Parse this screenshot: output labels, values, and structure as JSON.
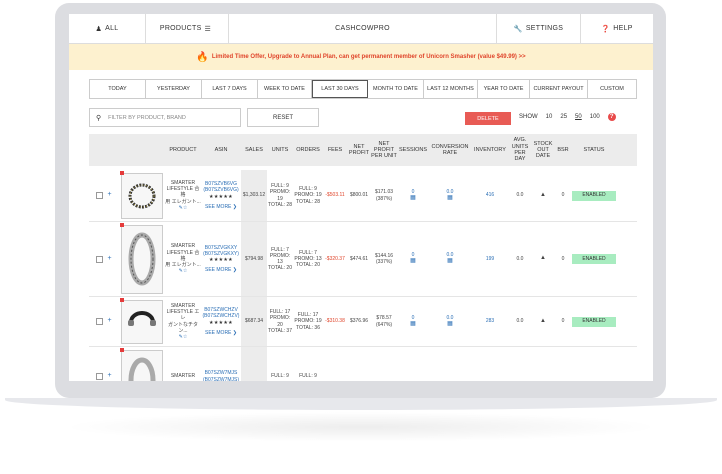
{
  "nav": {
    "all": "ALL",
    "products": "PRODUCTS",
    "brand": "CASHCOWPRO",
    "settings": "SETTINGS",
    "help": "HELP"
  },
  "banner": {
    "text": "Limited Time Offer, Upgrade to Annual Plan, can get permanent member of Unicorn Smasher (value $49.99) >>"
  },
  "dates": [
    "TODAY",
    "YESTERDAY",
    "LAST 7 DAYS",
    "WEEK TO DATE",
    "LAST 30 DAYS",
    "MONTH TO DATE",
    "LAST 12 MONTHS",
    "YEAR TO DATE",
    "CURRENT PAYOUT",
    "CUSTOM"
  ],
  "active_date": "LAST 30 DAYS",
  "filter": {
    "placeholder": "FILTER BY PRODUCT, BRAND"
  },
  "reset_label": "RESET",
  "delete_label": "DELETE",
  "show": {
    "label": "SHOW",
    "options": [
      "10",
      "25",
      "50",
      "100"
    ],
    "selected": "50"
  },
  "columns": {
    "product": "PRODUCT",
    "asin": "ASIN",
    "sales": "SALES",
    "units": "UNITS",
    "orders": "ORDERS",
    "fees": "FEES",
    "net_profit": "NET PROFIT",
    "net_profit_per_unit": "NET PROFIT PER UNIT",
    "sessions": "SESSIONS",
    "conversion_rate": "CONVERSION RATE",
    "inventory": "INVENTORY",
    "avg_units_per_day": "AVG. UNITS PER DAY",
    "stock_out_date": "STOCK OUT DATE",
    "bsr": "BSR",
    "status": "STATUS"
  },
  "rows": [
    {
      "product_l1": "SMARTER",
      "product_l2": "LIFESTYLE 合格",
      "product_l3": "用 エレガント...",
      "asin1": "B07SZVB6VG",
      "asin2": "(B07SZVB6VG)",
      "stars": "★★★★★",
      "see_more": "SEE MORE",
      "sales": "$1,303.12",
      "units_full": "FULL: 9",
      "units_promo": "PROMO:",
      "units_promo_v": "19",
      "units_total": "TOTAL: 28",
      "orders_full": "FULL: 9",
      "orders_promo": "PROMO: 19",
      "orders_total": "TOTAL: 28",
      "fees": "-$503.11",
      "net_profit": "$800.01",
      "nppu1": "$171.03",
      "nppu2": "(387%)",
      "sessions": "0",
      "conversion": "0.0",
      "inventory": "416",
      "avg": "0.0",
      "bsr": "0",
      "status": "ENABLED"
    },
    {
      "product_l1": "SMARTER",
      "product_l2": "LIFESTYLE 合格",
      "product_l3": "用 エレガント...",
      "asin1": "B07SZVGKXY",
      "asin2": "(B07SZVGKXY)",
      "stars": "★★★★★",
      "see_more": "SEE MORE",
      "sales": "$794.98",
      "units_full": "FULL: 7",
      "units_promo": "PROMO:",
      "units_promo_v": "13",
      "units_total": "TOTAL: 20",
      "orders_full": "FULL: 7",
      "orders_promo": "PROMO: 13",
      "orders_total": "TOTAL: 20",
      "fees": "-$320.37",
      "net_profit": "$474.61",
      "nppu1": "$144.16",
      "nppu2": "(337%)",
      "sessions": "0",
      "conversion": "0.0",
      "inventory": "199",
      "avg": "0.0",
      "bsr": "0",
      "status": "ENABLED"
    },
    {
      "product_l1": "SMARTER",
      "product_l2": "LIFESTYLE エレ",
      "product_l3": "ガントなチタン...",
      "asin1": "B07SZWCHZV",
      "asin2": "(B07SZWCHZV)",
      "stars": "★★★★★",
      "see_more": "SEE MORE",
      "sales": "$687.34",
      "units_full": "FULL: 17",
      "units_promo": "PROMO:",
      "units_promo_v": "20",
      "units_total": "TOTAL: 37",
      "orders_full": "FULL: 17",
      "orders_promo": "PROMO: 19",
      "orders_total": "TOTAL: 36",
      "fees": "-$310.38",
      "net_profit": "$376.96",
      "nppu1": "$78.57",
      "nppu2": "(647%)",
      "sessions": "0",
      "conversion": "0.0",
      "inventory": "283",
      "avg": "0.0",
      "bsr": "0",
      "status": "ENABLED"
    },
    {
      "product_l1": "SMARTER",
      "product_l2": "",
      "product_l3": "",
      "asin1": "B07SZW7MJS",
      "asin2": "(B07SZW7MJS)",
      "stars": "",
      "see_more": "",
      "sales": "",
      "units_full": "FULL: 9",
      "units_promo": "",
      "units_promo_v": "",
      "units_total": "",
      "orders_full": "FULL: 9",
      "orders_promo": "",
      "orders_total": "",
      "fees": "",
      "net_profit": "",
      "nppu1": "",
      "nppu2": "",
      "sessions": "",
      "conversion": "",
      "inventory": "",
      "avg": "",
      "bsr": "",
      "status": ""
    }
  ]
}
